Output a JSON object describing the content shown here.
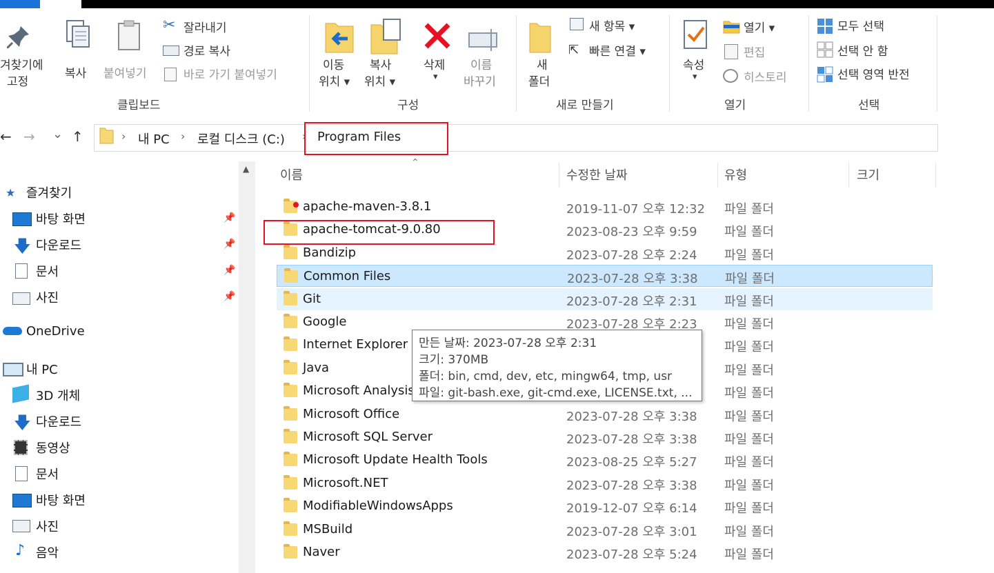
{
  "ribbon": {
    "clipboard": {
      "pin_label_1": "겨찾기에",
      "pin_label_2": "고정",
      "copy": "복사",
      "paste": "붙여넣기",
      "cut": "잘라내기",
      "copy_path": "경로 복사",
      "paste_shortcut": "바로 가기 붙여넣기",
      "group": "클립보드"
    },
    "organize": {
      "move_1": "이동",
      "move_2": "위치 ▾",
      "copy_1": "복사",
      "copy_2": "위치 ▾",
      "delete": "삭제",
      "delete_arrow": "▾",
      "rename_1": "이름",
      "rename_2": "바꾸기",
      "group": "구성"
    },
    "new": {
      "folder_1": "새",
      "folder_2": "폴더",
      "new_item": "새 항목 ▾",
      "easy_access": "빠른 연결 ▾",
      "group": "새로 만들기"
    },
    "open": {
      "properties": "속성",
      "properties_arrow": "▾",
      "open": "열기 ▾",
      "edit": "편집",
      "history": "히스토리",
      "group": "열기"
    },
    "select": {
      "select_all": "모두 선택",
      "select_none": "선택 안 함",
      "invert": "선택 영역 반전",
      "group": "선택"
    }
  },
  "nav_buttons": {
    "back": "←",
    "forward": "→",
    "recent": "⌄",
    "up": "↑"
  },
  "breadcrumb": [
    "내 PC",
    "로컬 디스크 (C:)",
    "Program Files"
  ],
  "sidebar": {
    "quick_access": "즐겨찾기",
    "quick_items": [
      "바탕 화면",
      "다운로드",
      "문서",
      "사진"
    ],
    "onedrive": "OneDrive",
    "this_pc": "내 PC",
    "pc_items": [
      "3D 개체",
      "다운로드",
      "동영상",
      "문서",
      "바탕 화면",
      "사진",
      "음악"
    ]
  },
  "columns": {
    "name": "이름",
    "modified": "수정한 날짜",
    "type": "유형",
    "size": "크기"
  },
  "files": [
    {
      "name": "apache-maven-3.8.1",
      "date": "2019-11-07 오후 12:32",
      "type": "파일 폴더"
    },
    {
      "name": "apache-tomcat-9.0.80",
      "date": "2023-08-23 오후 9:59",
      "type": "파일 폴더"
    },
    {
      "name": "Bandizip",
      "date": "2023-07-28 오후 2:24",
      "type": "파일 폴더"
    },
    {
      "name": "Common Files",
      "date": "2023-07-28 오후 3:38",
      "type": "파일 폴더"
    },
    {
      "name": "Git",
      "date": "2023-07-28 오후 2:31",
      "type": "파일 폴더"
    },
    {
      "name": "Google",
      "date": "2023-07-28 오후 2:23",
      "type": "파일 폴더"
    },
    {
      "name": "Internet Explorer",
      "date": "",
      "type": "파일 폴더"
    },
    {
      "name": "Java",
      "date": "",
      "type": "파일 폴더"
    },
    {
      "name": "Microsoft Analysis",
      "date": "",
      "type": "파일 폴더"
    },
    {
      "name": "Microsoft Office",
      "date": "2023-07-28 오후 3:38",
      "type": "파일 폴더"
    },
    {
      "name": "Microsoft SQL Server",
      "date": "2023-07-28 오후 3:38",
      "type": "파일 폴더"
    },
    {
      "name": "Microsoft Update Health Tools",
      "date": "2023-08-25 오후 5:27",
      "type": "파일 폴더"
    },
    {
      "name": "Microsoft.NET",
      "date": "2023-07-28 오후 3:38",
      "type": "파일 폴더"
    },
    {
      "name": "ModifiableWindowsApps",
      "date": "2019-12-07 오후 6:14",
      "type": "파일 폴더"
    },
    {
      "name": "MSBuild",
      "date": "2023-07-28 오후 3:01",
      "type": "파일 폴더"
    },
    {
      "name": "Naver",
      "date": "2023-07-28 오후 5:24",
      "type": "파일 폴더"
    }
  ],
  "tooltip": {
    "created": "만든 날짜: 2023-07-28 오후 2:31",
    "size": "크기: 370MB",
    "folders": "폴더: bin, cmd, dev, etc, mingw64, tmp, usr",
    "files": "파일: git-bash.exe, git-cmd.exe, LICENSE.txt, ..."
  },
  "colors": {
    "selection": "#cce8ff",
    "hover": "#e5f3ff",
    "highlight_box": "#e81123",
    "accent": "#1a73d9"
  }
}
